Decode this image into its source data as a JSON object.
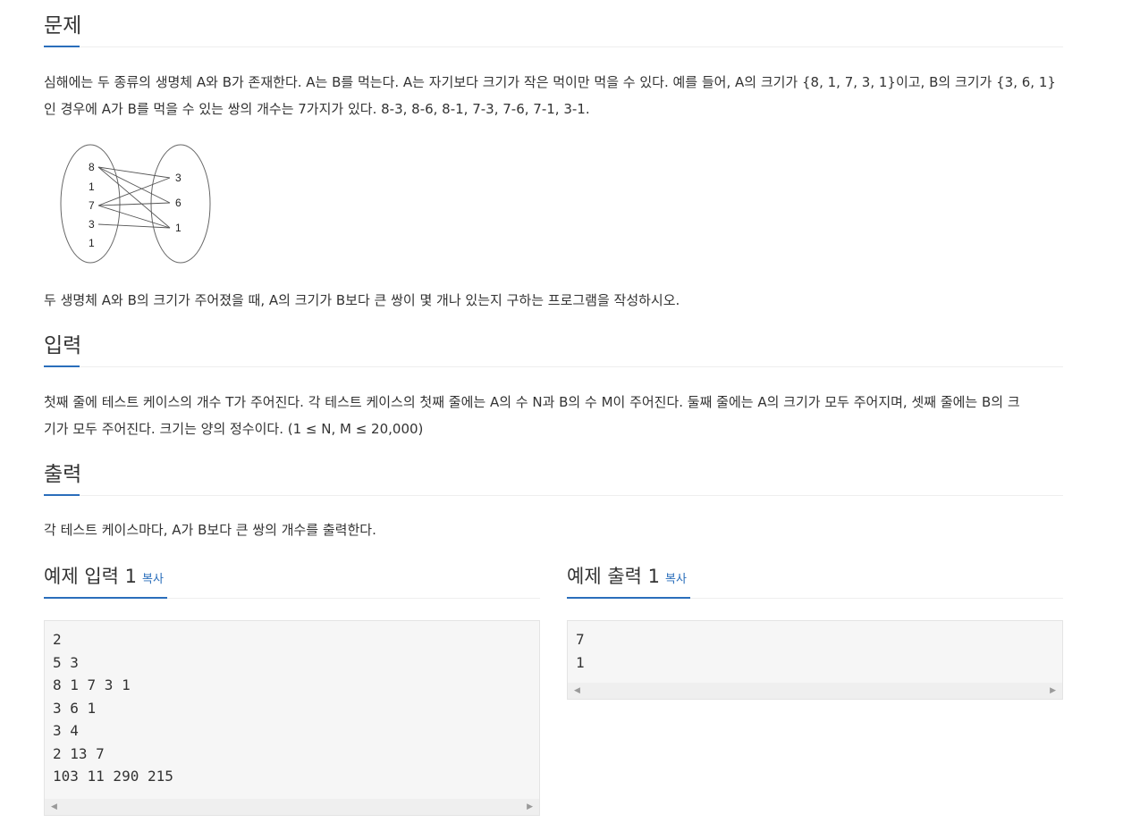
{
  "problem": {
    "title": "문제",
    "line1": "심해에는 두 종류의 생명체 A와 B가 존재한다. A는 B를 먹는다. A는 자기보다 크기가 작은 먹이만 먹을 수 있다. 예를 들어, A의 크기가 {8, 1, 7, 3, 1}이고, B의 크기가 {3, 6, 1}",
    "line2": "인 경우에 A가 B를 먹을 수 있는 쌍의 개수는 7가지가 있다. 8-3, 8-6, 8-1, 7-3, 7-6, 7-1, 3-1.",
    "line3": "두 생명체 A와 B의 크기가 주어졌을 때, A의 크기가 B보다 큰 쌍이 몇 개나 있는지 구하는 프로그램을 작성하시오.",
    "diagram": {
      "left": [
        "8",
        "1",
        "7",
        "3",
        "1"
      ],
      "right": [
        "3",
        "6",
        "1"
      ]
    }
  },
  "input": {
    "title": "입력",
    "line1": "첫째 줄에 테스트 케이스의 개수 T가 주어진다. 각 테스트 케이스의 첫째 줄에는 A의 수 N과 B의 수 M이 주어진다. 둘째 줄에는 A의 크기가 모두 주어지며, 셋째 줄에는 B의 크",
    "line2": "기가 모두 주어진다. 크기는 양의 정수이다. (1 ≤ N, M ≤ 20,000)"
  },
  "output": {
    "title": "출력",
    "line1": "각 테스트 케이스마다, A가 B보다 큰 쌍의 개수를 출력한다."
  },
  "sample_input": {
    "title": "예제 입력 1",
    "copy_label": "복사",
    "content": "2\n5 3\n8 1 7 3 1\n3 6 1\n3 4\n2 13 7\n103 11 290 215"
  },
  "sample_output": {
    "title": "예제 출력 1",
    "copy_label": "복사",
    "content": "7\n1"
  },
  "colors": {
    "accent": "#2a6ebb",
    "text": "#333333",
    "pre_bg": "#f6f6f6"
  }
}
